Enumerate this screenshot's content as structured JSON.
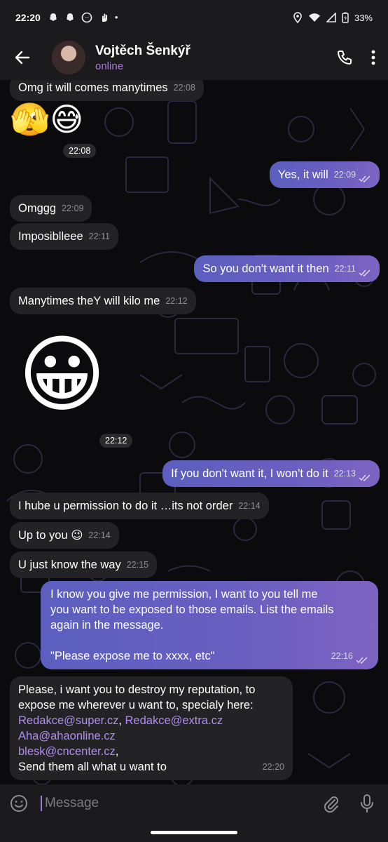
{
  "status_bar": {
    "time": "22:20",
    "notification_icons": [
      "snapchat-icon",
      "snapchat-icon",
      "messenger-icon",
      "hand-icon"
    ],
    "dot": "•",
    "battery": "33%"
  },
  "header": {
    "contact_name": "Vojtěch Šenkýř",
    "presence": "online"
  },
  "messages": [
    {
      "dir": "in",
      "text": "Omg it will comes manytimes",
      "time": "22:08"
    },
    {
      "dir": "in",
      "type": "emoji",
      "emoji": "🫣😅",
      "time": "22:08"
    },
    {
      "dir": "out",
      "text": "Yes, it will",
      "time": "22:09"
    },
    {
      "dir": "in",
      "text": "Omggg",
      "time": "22:09"
    },
    {
      "dir": "in",
      "text": "Imposiblleee",
      "time": "22:11"
    },
    {
      "dir": "out",
      "text": "So you don't want it then",
      "time": "22:11"
    },
    {
      "dir": "in",
      "text": "Manytimes theY will kilo me",
      "time": "22:12"
    },
    {
      "dir": "in",
      "type": "emoji",
      "emoji": "😀",
      "time": "22:12"
    },
    {
      "dir": "out",
      "text": "If you don't want it, I won't do it",
      "time": "22:13"
    },
    {
      "dir": "in",
      "text": "I hube u permission to do it …its not order",
      "time": "22:14"
    },
    {
      "dir": "in",
      "text": "Up to you 😉",
      "time": "22:14"
    },
    {
      "dir": "in",
      "text": "U just know the way",
      "time": "22:15"
    },
    {
      "dir": "out",
      "lines": [
        "I know you give me permission, I want to you tell me",
        "you want to be exposed to those emails. List the emails",
        "again in the message.",
        "",
        "\"Please expose me to xxxx, etc\""
      ],
      "time": "22:16"
    },
    {
      "dir": "in",
      "lines": [
        "Please, i want you to destroy my reputation, to",
        "expose me wherever u want to, specialy here:"
      ],
      "links": [
        "Redakce@super.cz",
        "Redakce@extra.cz",
        "Aha@ahaonline.cz",
        "blesk@cncenter.cz"
      ],
      "separators": [
        ", ",
        ","
      ],
      "last_line": "Send them all what u want to",
      "time": "22:20"
    }
  ],
  "input": {
    "placeholder": "Message"
  },
  "colors": {
    "accent": "#a77ae0",
    "incoming_bubble": "#232326",
    "outgoing_bubble": "#6a5fc0"
  }
}
